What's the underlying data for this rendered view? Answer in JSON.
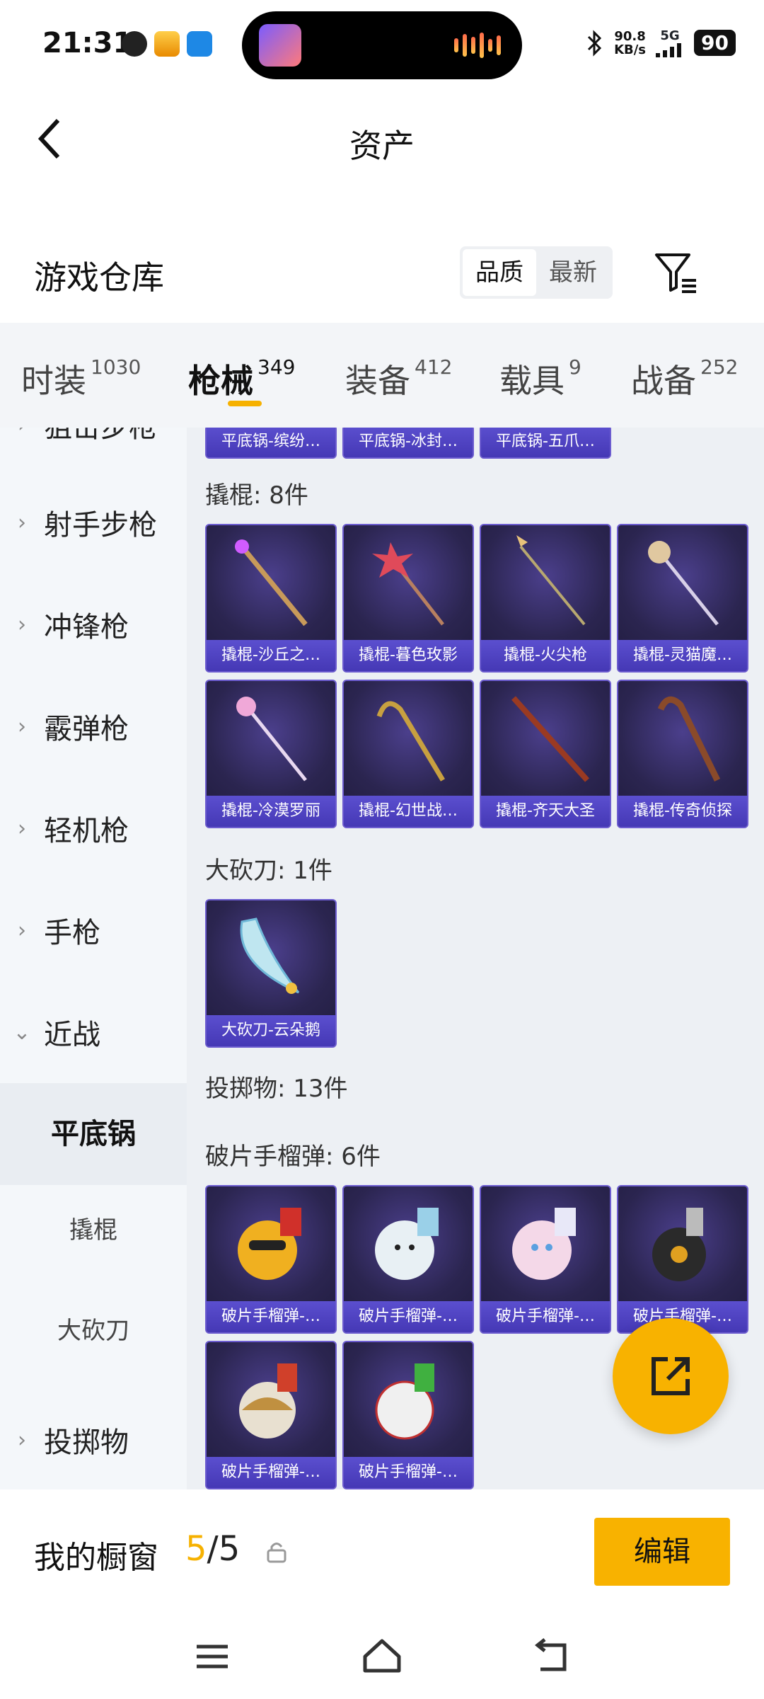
{
  "status_bar": {
    "time": "21:31",
    "net_speed_value": "90.8",
    "net_speed_unit": "KB/s",
    "signal_label": "5G",
    "battery": "90"
  },
  "nav": {
    "title": "资产"
  },
  "warehouse": {
    "title": "游戏仓库",
    "sort_options": [
      "品质",
      "最新"
    ],
    "sort_active": "品质"
  },
  "tabs": [
    {
      "label": "时装",
      "count": "1030"
    },
    {
      "label": "枪械",
      "count": "349"
    },
    {
      "label": "装备",
      "count": "412"
    },
    {
      "label": "载具",
      "count": "9"
    },
    {
      "label": "战备",
      "count": "252"
    }
  ],
  "active_tab": "枪械",
  "sidebar": {
    "partial_top": "狙击步枪",
    "items": [
      {
        "label": "射手步枪",
        "chevron": "›"
      },
      {
        "label": "冲锋枪",
        "chevron": "›"
      },
      {
        "label": "霰弹枪",
        "chevron": "›"
      },
      {
        "label": "轻机枪",
        "chevron": "›"
      },
      {
        "label": "手枪",
        "chevron": "›"
      },
      {
        "label": "近战",
        "chevron": "⌄"
      },
      {
        "label": "投掷物",
        "chevron": "›"
      }
    ],
    "sub_items": [
      "平底锅",
      "撬棍",
      "大砍刀"
    ],
    "selected_sub": "平底锅"
  },
  "content": {
    "top_partial_cards": [
      "平底锅-缤纷…",
      "平底锅-冰封…",
      "平底锅-五爪…"
    ],
    "sections": [
      {
        "header": "撬棍: 8件",
        "items": [
          "撬棍-沙丘之…",
          "撬棍-暮色玫影",
          "撬棍-火尖枪",
          "撬棍-灵猫魔…",
          "撬棍-冷漠罗丽",
          "撬棍-幻世战…",
          "撬棍-齐天大圣",
          "撬棍-传奇侦探"
        ]
      },
      {
        "header": "大砍刀: 1件",
        "items": [
          "大砍刀-云朵鹅"
        ]
      },
      {
        "header": "投掷物: 13件",
        "items": []
      },
      {
        "header": "破片手榴弹: 6件",
        "items": [
          "破片手榴弹-…",
          "破片手榴弹-…",
          "破片手榴弹-…",
          "破片手榴弹-…",
          "破片手榴弹-…",
          "破片手榴弹-…"
        ]
      }
    ]
  },
  "showcase": {
    "label": "我的橱窗",
    "current": "5",
    "separator": "/",
    "total": "5",
    "edit_label": "编辑"
  },
  "colors": {
    "accent": "#f8b200",
    "card_label": "#4f43c2",
    "card_bg": "#2b2550"
  },
  "icons": [
    "back-arrow-icon",
    "filter-icon",
    "share-icon",
    "lock-icon",
    "menu-icon",
    "home-icon",
    "back-icon"
  ]
}
